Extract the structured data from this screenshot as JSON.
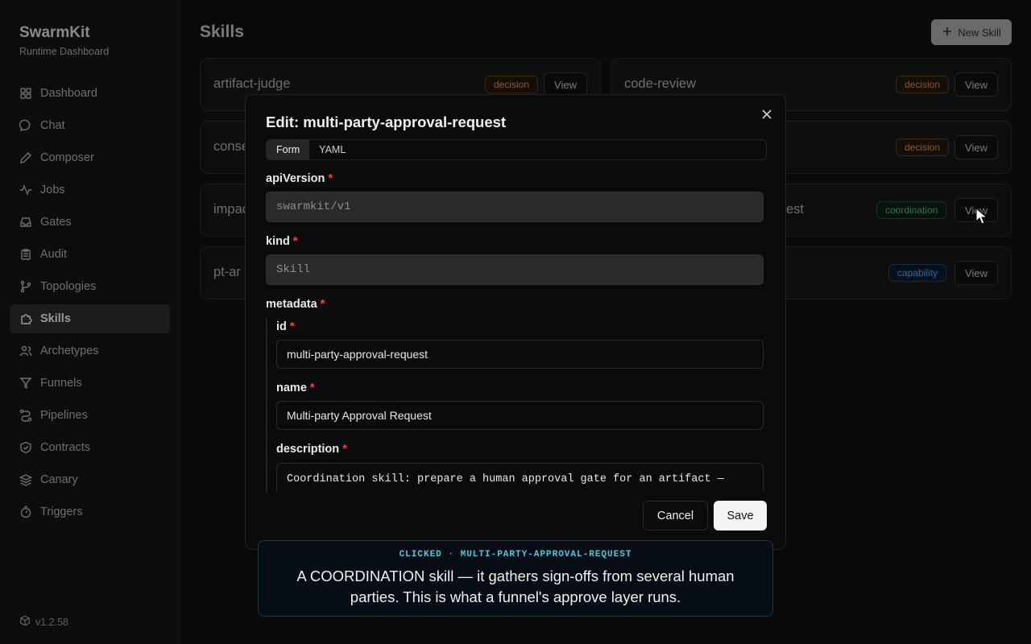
{
  "sidebar": {
    "brand": "SwarmKit",
    "subtitle": "Runtime Dashboard",
    "items": [
      {
        "label": "Dashboard",
        "icon": "grid-icon"
      },
      {
        "label": "Chat",
        "icon": "chat-bubble-icon"
      },
      {
        "label": "Composer",
        "icon": "pen-icon"
      },
      {
        "label": "Jobs",
        "icon": "activity-icon"
      },
      {
        "label": "Gates",
        "icon": "inbox-icon"
      },
      {
        "label": "Audit",
        "icon": "clipboard-icon"
      },
      {
        "label": "Topologies",
        "icon": "branch-icon"
      },
      {
        "label": "Skills",
        "icon": "puzzle-icon",
        "active": true
      },
      {
        "label": "Archetypes",
        "icon": "users-icon"
      },
      {
        "label": "Funnels",
        "icon": "funnel-icon"
      },
      {
        "label": "Pipelines",
        "icon": "workflow-icon"
      },
      {
        "label": "Contracts",
        "icon": "shield-icon"
      },
      {
        "label": "Canary",
        "icon": "layers-icon"
      },
      {
        "label": "Triggers",
        "icon": "timer-icon"
      }
    ],
    "version": "v1.2.58"
  },
  "header": {
    "title": "Skills",
    "new_button": "New Skill"
  },
  "cards": [
    {
      "name": "artifact-judge",
      "badge": "decision",
      "view": "View"
    },
    {
      "name": "code-review",
      "badge": "decision",
      "view": "View"
    },
    {
      "name": "conse",
      "badge": "",
      "view": ""
    },
    {
      "name": "",
      "badge": "decision",
      "view": "View"
    },
    {
      "name": "impac",
      "badge": "",
      "view": ""
    },
    {
      "name": "est",
      "badge": "coordination",
      "view": "View"
    },
    {
      "name": "pt-ar",
      "badge": "",
      "view": ""
    },
    {
      "name": "",
      "badge": "capability",
      "view": "View"
    }
  ],
  "modal": {
    "title": "Edit: multi-party-approval-request",
    "tabs": [
      "Form",
      "YAML"
    ],
    "fields": {
      "apiVersion": {
        "label": "apiVersion",
        "value": "swarmkit/v1"
      },
      "kind": {
        "label": "kind",
        "value": "Skill"
      },
      "metadata": {
        "label": "metadata"
      },
      "id": {
        "label": "id",
        "value": "multi-party-approval-request"
      },
      "name": {
        "label": "name",
        "value": "Multi-party Approval Request"
      },
      "description": {
        "label": "description",
        "value": "Coordination skill: prepare a human approval gate for an artifact —"
      }
    },
    "required_mark": "*",
    "cancel": "Cancel",
    "save": "Save"
  },
  "caption": {
    "kicker": "CLICKED · MULTI-PARTY-APPROVAL-REQUEST",
    "text": "A COORDINATION skill — it gathers sign-offs from several human parties. This is what a funnel's approve layer runs."
  },
  "colors": {
    "decision": "#8b5a1f",
    "coordination": "#2a7a4e",
    "capability": "#2c6a9c",
    "required": "#ef4444",
    "accent": "#4ec9e0"
  }
}
